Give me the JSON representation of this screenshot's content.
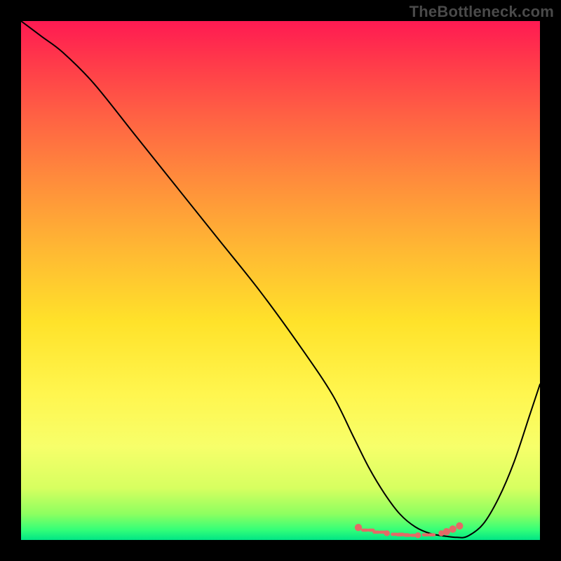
{
  "watermark": "TheBottleneck.com",
  "colors": {
    "frame": "#000000",
    "curve": "#000000",
    "marker": "#e46a66"
  },
  "chart_data": {
    "type": "line",
    "title": "",
    "xlabel": "",
    "ylabel": "",
    "xlim": [
      0,
      100
    ],
    "ylim": [
      0,
      100
    ],
    "grid": false,
    "legend": false,
    "series": [
      {
        "name": "bottleneck-curve",
        "x": [
          0,
          4,
          8,
          14,
          22,
          30,
          38,
          46,
          54,
          60,
          64,
          67,
          70,
          73,
          76,
          79,
          82,
          84,
          86,
          89,
          92,
          95,
          98,
          100
        ],
        "y": [
          100,
          97,
          94,
          88,
          78,
          68,
          58,
          48,
          37,
          28,
          20,
          14,
          9,
          5,
          2.5,
          1.2,
          0.7,
          0.5,
          0.7,
          3,
          8,
          15,
          24,
          30
        ]
      }
    ],
    "markers": {
      "name": "optimal-band-dots",
      "x": [
        65.0,
        66.8,
        69.0,
        70.5,
        72.5,
        73.5,
        75.0,
        76.5,
        78.5,
        81.0,
        82.0,
        83.2,
        84.5
      ],
      "y": [
        2.4,
        1.9,
        1.5,
        1.3,
        1.1,
        1.0,
        0.9,
        0.9,
        1.0,
        1.3,
        1.6,
        2.1,
        2.7
      ]
    }
  }
}
